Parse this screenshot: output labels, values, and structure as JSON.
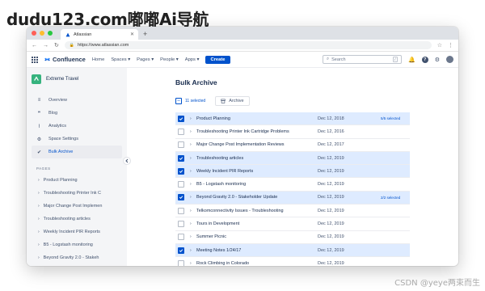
{
  "watermark": {
    "top": "dudu123.com嘟嘟Ai导航",
    "bottom": "CSDN @yeye两束而生"
  },
  "browser": {
    "tab_title": "Atlassian",
    "url": "https://www.atlassian.com",
    "traffic_colors": [
      "#ff5f57",
      "#febc2e",
      "#28c840"
    ]
  },
  "header": {
    "app_name": "Confluence",
    "nav": [
      "Home",
      "Spaces ▾",
      "Pages ▾",
      "People ▾",
      "Apps ▾"
    ],
    "create_label": "Create",
    "search_placeholder": "Search",
    "search_shortcut": "/",
    "help_label": "?"
  },
  "sidebar": {
    "space_name": "Extreme Travel",
    "items": [
      {
        "label": "Overview",
        "icon": "overview-icon"
      },
      {
        "label": "Blog",
        "icon": "blog-icon"
      },
      {
        "label": "Analytics",
        "icon": "analytics-icon"
      },
      {
        "label": "Space Settings",
        "icon": "settings-icon"
      },
      {
        "label": "Bulk Archive",
        "icon": "archive-icon"
      }
    ],
    "pages_header": "PAGES",
    "tree": [
      "Product Planning",
      "Troubleshooting Printer Ink C",
      "Major Change Post Implemen",
      "Troubleshooting articles",
      "Weekly Incident PIR Reports",
      "B5 - Logstash monitoring",
      "Beyond Gravity 2.0 - Stakeh"
    ]
  },
  "main": {
    "title": "Bulk Archive",
    "selected_count": "11 selected",
    "archive_label": "Archive",
    "rows": [
      {
        "title": "Product Planning",
        "date": "Dec 12, 2018",
        "note": "5/5 selected",
        "checked": true
      },
      {
        "title": "Troubleshooting Printer Ink Cartridge Problems",
        "date": "Dec 12, 2016",
        "note": "",
        "checked": false
      },
      {
        "title": "Major Change Post Implementation Reviews",
        "date": "Dec 12, 2017",
        "note": "",
        "checked": false
      },
      {
        "title": "Troubleshooting articles",
        "date": "Dec 12, 2019",
        "note": "",
        "checked": true
      },
      {
        "title": "Weekly Incident PIR Reports",
        "date": "Dec 12, 2019",
        "note": "",
        "checked": true
      },
      {
        "title": "B5 - Logstash monitoring",
        "date": "Dec 12, 2019",
        "note": "",
        "checked": false
      },
      {
        "title": "Beyond Gravity 2.0 - Stakeholder Update",
        "date": "Dec 12, 2019",
        "note": "2/2 selected",
        "checked": true
      },
      {
        "title": "Telkomconnectivity Issues - Troubleshooting",
        "date": "Dec 12, 2019",
        "note": "",
        "checked": false
      },
      {
        "title": "Tours in Development",
        "date": "Dec 12, 2019",
        "note": "",
        "checked": false
      },
      {
        "title": "Summer Picnic",
        "date": "Dec 12, 2019",
        "note": "",
        "checked": false
      },
      {
        "title": "Meeting Notes 1/24/17",
        "date": "Dec 12, 2019",
        "note": "",
        "checked": true
      },
      {
        "title": "Rock Climbing in Colorado",
        "date": "Dec 12, 2019",
        "note": "",
        "checked": false
      }
    ]
  }
}
